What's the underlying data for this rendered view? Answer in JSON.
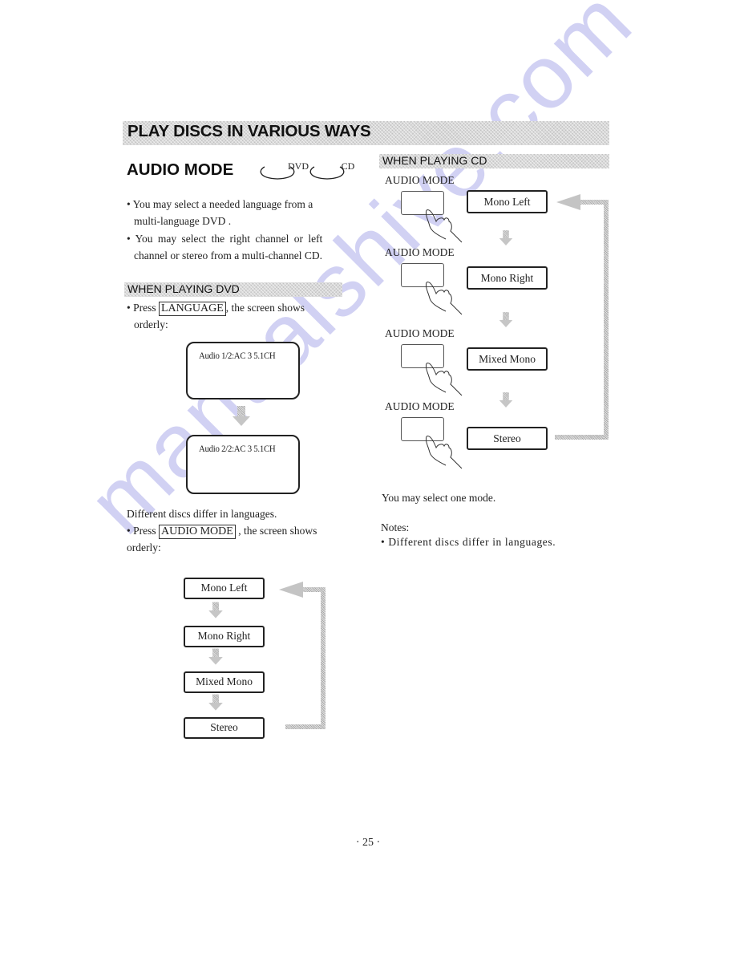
{
  "header": {
    "title": "PLAY DISCS IN VARIOUS WAYS"
  },
  "section": {
    "title": "AUDIO MODE",
    "disc_badges": [
      "DVD",
      "CD"
    ]
  },
  "intro": {
    "bullets": [
      "You may select a needed language from a multi-language DVD .",
      "You may select the right channel or left channel or stereo from a multi-channel CD."
    ],
    "bullet_lines": [
      [
        "You may select a needed language from a",
        "multi-language DVD ."
      ],
      [
        "You may select the right channel or left",
        "channel or stereo from a multi-channel CD."
      ]
    ]
  },
  "dvd": {
    "heading": "WHEN PLAYING DVD",
    "press_prefix": "Press",
    "language_key": "LANGUAGE",
    "press_suffix": ", the screen shows",
    "press_line2": "orderly:",
    "screens": [
      "Audio 1/2:AC 3  5.1CH",
      "Audio 2/2:AC 3  5.1CH"
    ],
    "note": "Different discs differ in languages.",
    "audio_prefix": "Press",
    "audio_key": "AUDIO MODE",
    "audio_suffix": ", the screen  shows",
    "audio_line2": "orderly:",
    "modes": [
      "Mono Left",
      "Mono Right",
      "Mixed Mono",
      "Stereo"
    ]
  },
  "cd": {
    "heading": "WHEN PLAYING CD",
    "button_label": "AUDIO MODE",
    "modes": [
      "Mono Left",
      "Mono Right",
      "Mixed Mono",
      "Stereo"
    ],
    "summary": "You may select one mode.",
    "notes_label": "Notes:",
    "notes": [
      "Different discs differ in languages."
    ]
  },
  "watermark": "manualshive.com",
  "page_number": "· 25 ·"
}
